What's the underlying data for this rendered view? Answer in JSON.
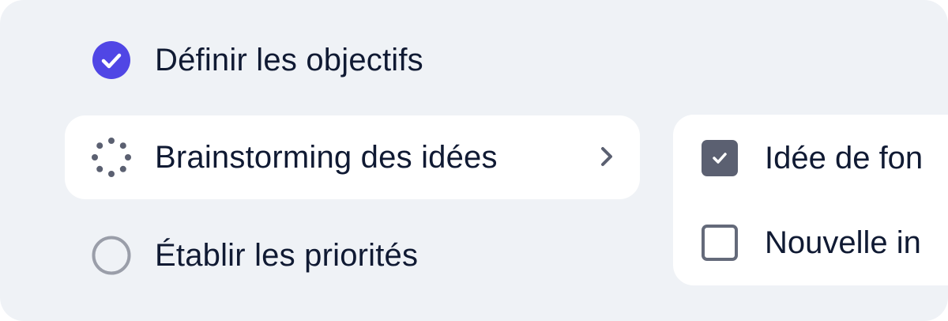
{
  "steps": [
    {
      "label": "Définir les objectifs",
      "state": "completed",
      "icon": "check-circle-icon"
    },
    {
      "label": "Brainstorming des idées",
      "state": "in-progress",
      "icon": "spinner-dots-icon"
    },
    {
      "label": "Établir les priorités",
      "state": "pending",
      "icon": "empty-circle-icon"
    }
  ],
  "substeps": [
    {
      "label": "Idée de fon",
      "checked": true
    },
    {
      "label": "Nouvelle in",
      "checked": false
    }
  ],
  "colors": {
    "accent": "#5046e5",
    "background": "#eff2f6",
    "text": "#101a33",
    "checkbox": "#5b6071"
  }
}
